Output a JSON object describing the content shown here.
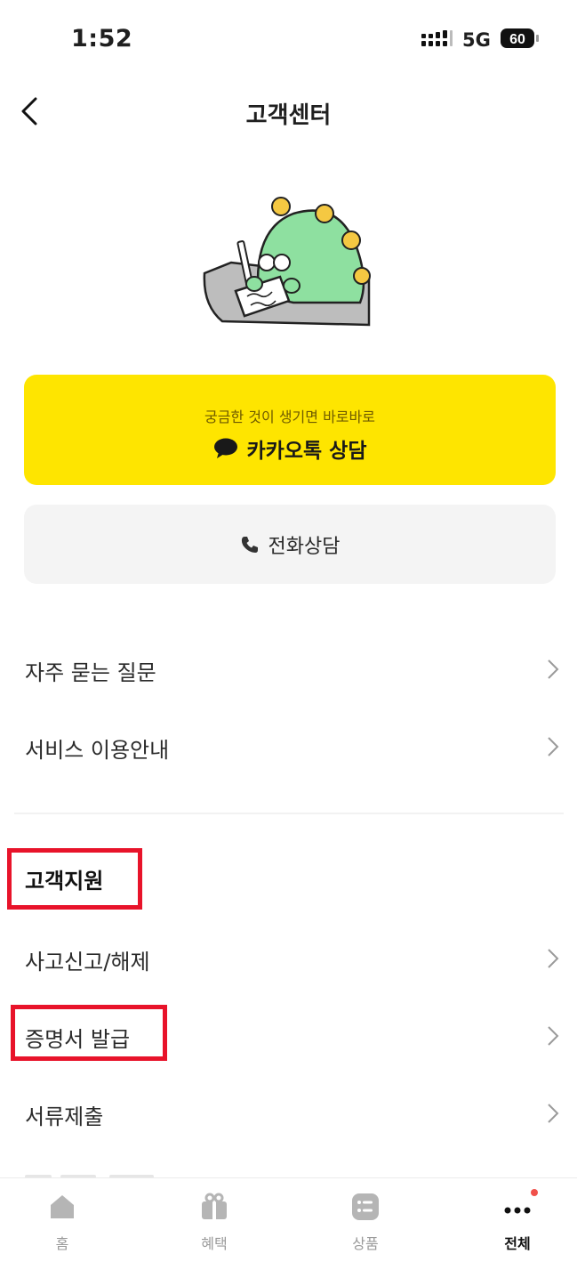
{
  "status": {
    "time": "1:52",
    "network": "5G",
    "battery": "60"
  },
  "header": {
    "title": "고객센터"
  },
  "kakao": {
    "subtitle": "궁금한 것이 생기면 바로바로",
    "label": "카카오톡 상담"
  },
  "phone": {
    "label": "전화상담"
  },
  "menu_general": [
    {
      "label": "자주 묻는 질문"
    },
    {
      "label": "서비스 이용안내"
    }
  ],
  "support": {
    "title": "고객지원",
    "items": [
      {
        "label": "사고신고/해제"
      },
      {
        "label": "증명서 발급"
      },
      {
        "label": "서류제출"
      }
    ]
  },
  "tabs": [
    {
      "label": "홈",
      "icon": "home-icon"
    },
    {
      "label": "혜택",
      "icon": "gift-icon"
    },
    {
      "label": "상품",
      "icon": "list-icon"
    },
    {
      "label": "전체",
      "icon": "more-icon",
      "active": true
    }
  ],
  "colors": {
    "kakao_yellow": "#fee500",
    "highlight_red": "#e8132a",
    "notification_dot": "#f0504a",
    "mascot_green": "#8ee0a0"
  }
}
